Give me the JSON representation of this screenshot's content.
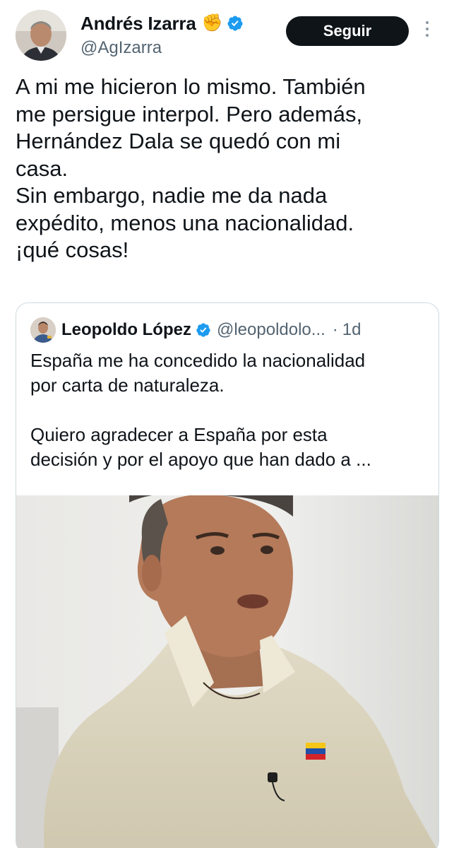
{
  "author": {
    "display_name": "Andrés Izarra",
    "emoji": "✊",
    "handle": "@AgIzarra",
    "verified": true,
    "avatar_icon": "profile-photo"
  },
  "follow_button": {
    "label": "Seguir"
  },
  "more_icon": "more-vertical-icon",
  "tweet": {
    "text": "A mi me hicieron lo mismo. También\nme persigue interpol. Pero además,\nHernández Dala se quedó con mi\ncasa.\nSin embargo, nadie me da nada\nexpédito, menos una nacionalidad.\n¡qué cosas!"
  },
  "quote": {
    "display_name": "Leopoldo López",
    "handle": "@leopoldolo...",
    "separator": "·",
    "time": "1d",
    "verified": true,
    "text": "España me ha concedido la nacionalidad\npor carta de naturaleza.\n\nQuiero agradecer a España por esta\ndecisión y por el apoyo que han dado a ...",
    "media_icon": "video-still-man-in-polo"
  },
  "colors": {
    "verified_blue": "#1d9bf0",
    "text": "#0f1419",
    "muted": "#536471",
    "border": "#cfd9de",
    "button_bg": "#0f1419"
  }
}
